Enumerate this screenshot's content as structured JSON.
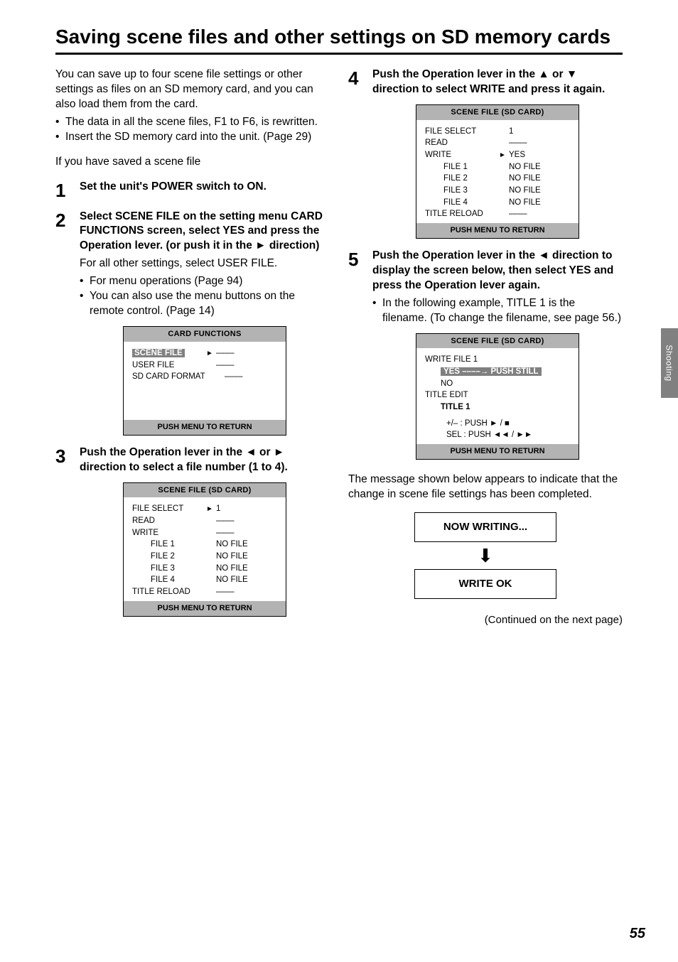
{
  "title": "Saving scene files and other settings on SD memory cards",
  "intro": {
    "p1": "You can save up to four scene file settings or other settings as files on an SD memory card, and you can also load them from the card.",
    "b1": "The data in all the scene files, F1 to F6, is rewritten.",
    "b2": "Insert the SD memory card into the unit. (Page 29)",
    "p2": "If you have saved a scene file"
  },
  "steps": {
    "s1": {
      "num": "1",
      "head": "Set the unit's POWER switch to ON."
    },
    "s2": {
      "num": "2",
      "head": "Select SCENE FILE on the setting menu CARD FUNCTIONS screen, select YES and press the Operation lever. (or push it in the ► direction)",
      "sub1": "For all other settings, select USER FILE.",
      "b1": "For menu operations (Page 94)",
      "b2": "You can also use the menu buttons on the remote control. (Page 14)"
    },
    "s3": {
      "num": "3",
      "head": "Push the Operation lever in the ◄ or ► direction to select a file number (1 to 4)."
    },
    "s4": {
      "num": "4",
      "head": "Push the Operation lever in the ▲ or ▼ direction to select WRITE and press it again."
    },
    "s5": {
      "num": "5",
      "head": "Push the Operation lever in the ◄ direction to display the screen below, then select YES and press the Operation lever again.",
      "b1": "In the following example, TITLE 1 is the filename. (To change the filename, see page 56.)"
    }
  },
  "menu1": {
    "title": "CARD FUNCTIONS",
    "r1": "SCENE FILE",
    "r2": "USER FILE",
    "r3": "SD CARD FORMAT",
    "dash": "––––",
    "footer": "PUSH  MENU TO RETURN"
  },
  "menu2": {
    "title": "SCENE FILE (SD CARD)",
    "file_select": "FILE SELECT",
    "one": "1",
    "read": "READ",
    "write": "WRITE",
    "f1": "FILE 1",
    "f2": "FILE 2",
    "f3": "FILE 3",
    "f4": "FILE 4",
    "nofile": "NO FILE",
    "title_reload": "TITLE RELOAD",
    "yes": "YES",
    "dash": "––––",
    "footer": "PUSH  MENU TO RETURN"
  },
  "menu3": {
    "title": "SCENE FILE (SD CARD)",
    "write_file": "WRITE FILE 1",
    "yes_push": "YES ––––→ PUSH STILL",
    "no": "NO",
    "title_edit": "TITLE EDIT",
    "title1": "TITLE 1",
    "pm": "+/– :",
    "push1": "PUSH ► / ■",
    "sel": "SEL :",
    "push2": "PUSH ◄◄ / ►►",
    "footer": "PUSH  MENU TO RETURN"
  },
  "result_intro": "The message shown below appears to indicate that the change in scene file settings has been completed.",
  "result": {
    "now": "NOW WRITING...",
    "ok": "WRITE OK"
  },
  "continued": "(Continued on the next page)",
  "sidetab": "Shooting",
  "pagenum": "55"
}
